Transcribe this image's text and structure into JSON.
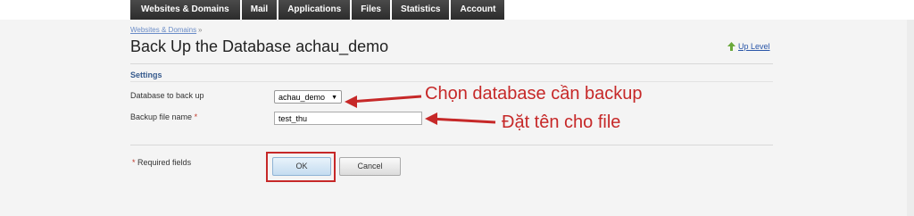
{
  "nav": {
    "tabs": [
      "Websites & Domains",
      "Mail",
      "Applications",
      "Files",
      "Statistics",
      "Account"
    ]
  },
  "breadcrumb": {
    "item": "Websites & Domains",
    "separator": "»"
  },
  "page": {
    "title": "Back Up the Database achau_demo",
    "up_level": "Up Level"
  },
  "settings": {
    "heading": "Settings",
    "database_label": "Database to back up",
    "database_value": "achau_demo",
    "filename_label": "Backup file name",
    "filename_value": "test_thu",
    "required_marker": "*"
  },
  "footer": {
    "required_note": "Required fields",
    "ok_label": "OK",
    "cancel_label": "Cancel"
  },
  "annotations": {
    "database": "Chọn database cần backup",
    "filename": "Đặt tên cho file"
  },
  "colors": {
    "annotation": "#c62828",
    "nav_bg": "#333333",
    "link": "#2a56a8"
  }
}
